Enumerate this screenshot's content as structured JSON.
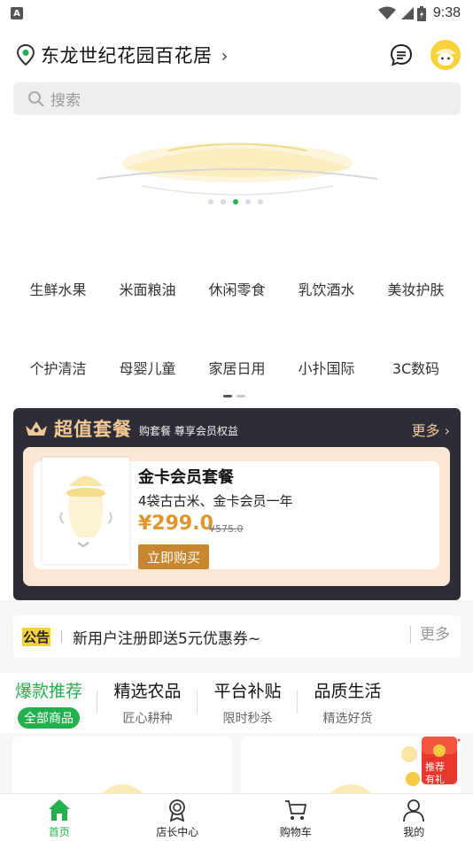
{
  "status_bar": {
    "time": "9:38",
    "notification_letter": "A"
  },
  "header": {
    "location": "东龙世纪花园百花居",
    "location_chevron": "›"
  },
  "search": {
    "placeholder": "搜索"
  },
  "banner": {
    "slide_count": 5,
    "active_index": 2
  },
  "categories": [
    [
      "生鲜水果",
      "米面粮油",
      "休闲零食",
      "乳饮酒水",
      "美妆护肤"
    ],
    [
      "个护清洁",
      "母婴儿童",
      "家居日用",
      "小扑国际",
      "3C数码"
    ]
  ],
  "package": {
    "title": "超值套餐",
    "subtitle": "购套餐 尊享会员权益",
    "more": "更多 ›",
    "item": {
      "name": "金卡会员套餐",
      "desc": "4袋古古米、金卡会员一年",
      "price": "¥299.0",
      "old_price": "¥575.0",
      "buy": "立即购买"
    }
  },
  "notice": {
    "tag": "公告",
    "text": "新用户注册即送5元优惠券~",
    "more": "更多"
  },
  "tabs": [
    {
      "title": "爆款推荐",
      "sub": "全部商品"
    },
    {
      "title": "精选农品",
      "sub": "匠心耕种"
    },
    {
      "title": "平台补贴",
      "sub": "限时秒杀"
    },
    {
      "title": "品质生活",
      "sub": "精选好货"
    }
  ],
  "gift": {
    "text1": "推荐",
    "text2": "有礼"
  },
  "nav": [
    {
      "label": "首页",
      "icon": "home-icon"
    },
    {
      "label": "店长中心",
      "icon": "badge-icon"
    },
    {
      "label": "购物车",
      "icon": "cart-icon"
    },
    {
      "label": "我的",
      "icon": "user-icon"
    }
  ],
  "colors": {
    "brand_green": "#22b14c",
    "gold": "#f2c994",
    "price_orange": "#e0962c"
  }
}
